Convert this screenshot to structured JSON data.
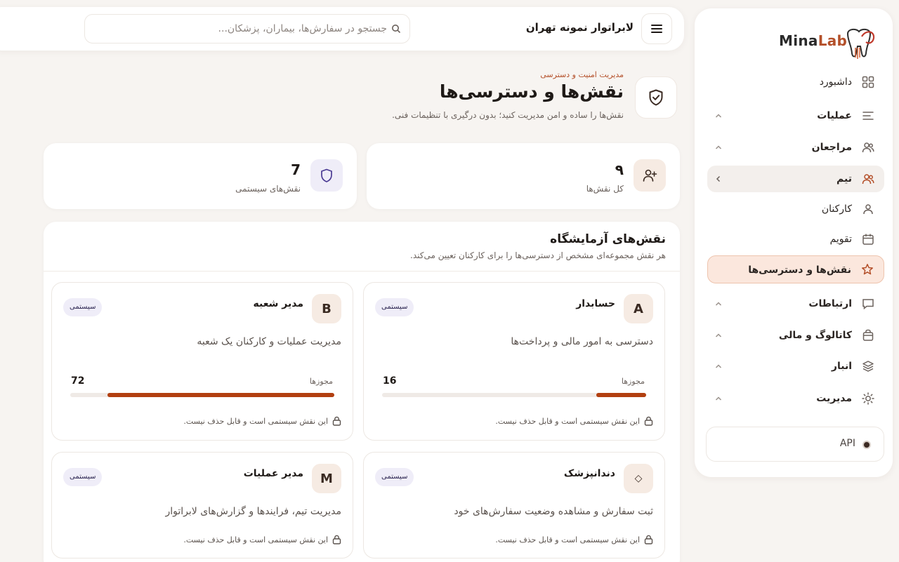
{
  "brand": {
    "name_part1": "Mina",
    "name_part2": "Lab",
    "accent": "#b4502a"
  },
  "sidebar": {
    "items": [
      {
        "key": "dashboard",
        "label": "داشبورد",
        "icon": "grid-icon",
        "top": 0
      },
      {
        "key": "operations",
        "label": "عملیات",
        "icon": "list-icon"
      },
      {
        "key": "clients",
        "label": "مراجعان",
        "icon": "users-icon"
      },
      {
        "key": "team",
        "label": "تیم",
        "icon": "team-icon"
      },
      {
        "key": "staff",
        "label": "کارکنان",
        "icon": "user-icon"
      },
      {
        "key": "calendar",
        "label": "تقویم",
        "icon": "calendar-icon"
      },
      {
        "key": "roles",
        "label": "نقش‌ها و دسترسی‌ها",
        "icon": "star-icon"
      },
      {
        "key": "communications",
        "label": "ارتباطات",
        "icon": "message-icon"
      },
      {
        "key": "catalog",
        "label": "کاتالوگ و مالی",
        "icon": "bag-icon"
      },
      {
        "key": "inventory",
        "label": "انبار",
        "icon": "layers-icon"
      },
      {
        "key": "management",
        "label": "مدیریت",
        "icon": "sun-icon"
      }
    ],
    "api_label": "API"
  },
  "header": {
    "lab_name": "لابراتوار نمونه تهران",
    "search_placeholder": "جستجو در سفارش‌ها، بیماران، پزشکان..."
  },
  "page": {
    "eyebrow": "مدیریت امنیت و دسترسی",
    "title": "نقش‌ها و دسترسی‌ها",
    "subtitle": "نقش‌ها را ساده و امن مدیریت کنید؛ بدون درگیری با تنظیمات فنی."
  },
  "stats": {
    "total": {
      "value": "۹",
      "label": "کل نقش‌ها"
    },
    "system": {
      "value": "7",
      "label": "نقش‌های سیستمی"
    }
  },
  "roles_panel": {
    "title": "نقش‌های آزمایشگاه",
    "subtitle": "هر نقش مجموعه‌ای مشخص از دسترسی‌ها را برای کارکنان تعیین می‌کند.",
    "roles": [
      {
        "avatar": "A",
        "name": "حسابدار",
        "badge": "سیستمی",
        "description": "دسترسی به امور مالی و پرداخت‌ها",
        "perm_label": "مجوزها",
        "perm_count": "16",
        "perm_fraction": 0.19,
        "lock_text": "این نقش سیستمی است و قابل حذف نیست."
      },
      {
        "avatar": "B",
        "name": "مدیر شعبه",
        "badge": "سیستمی",
        "description": "مدیریت عملیات و کارکنان یک شعبه",
        "perm_label": "مجوزها",
        "perm_count": "72",
        "perm_fraction": 0.86,
        "lock_text": "این نقش سیستمی است و قابل حذف نیست."
      },
      {
        "avatar": "◇",
        "name": "دندانپزشک",
        "badge": "سیستمی",
        "description": "ثبت سفارش و مشاهده وضعیت سفارش‌های خود",
        "lock_text": "این نقش سیستمی است و قابل حذف نیست."
      },
      {
        "avatar": "M",
        "name": "مدیر عملیات",
        "badge": "سیستمی",
        "description": "مدیریت تیم، فرایندها و گزارش‌های لابراتوار",
        "lock_text": "این نقش سیستمی است و قابل حذف نیست."
      }
    ]
  }
}
